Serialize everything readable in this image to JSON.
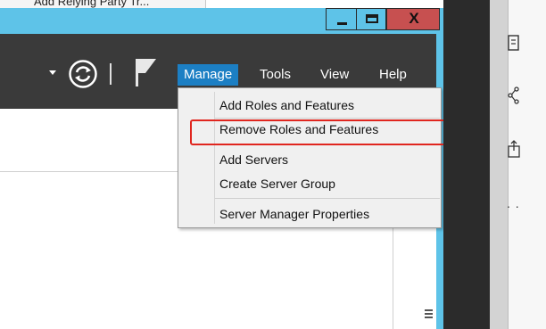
{
  "background_window": {
    "title": "Add Relying Party Tr..."
  },
  "window": {
    "controls": {
      "minimize_icon": "minimize-icon",
      "maximize_icon": "maximize-icon",
      "close_glyph": "X"
    }
  },
  "toolbar": {
    "refresh_icon": "refresh-icon",
    "flag_icon": "notifications-flag-icon",
    "menu": {
      "manage": "Manage",
      "tools": "Tools",
      "view": "View",
      "help": "Help"
    }
  },
  "manage_menu": {
    "items": [
      "Add Roles and Features",
      "Remove Roles and Features",
      "Add Servers",
      "Create Server Group",
      "Server Manager Properties"
    ],
    "highlighted_item": "Remove Roles and Features"
  },
  "colors": {
    "titlebar": "#5ec3e8",
    "toolbar": "#3a3a3a",
    "menu_active": "#1c7fc4",
    "close_button": "#c75050",
    "highlight": "#e0261f"
  }
}
